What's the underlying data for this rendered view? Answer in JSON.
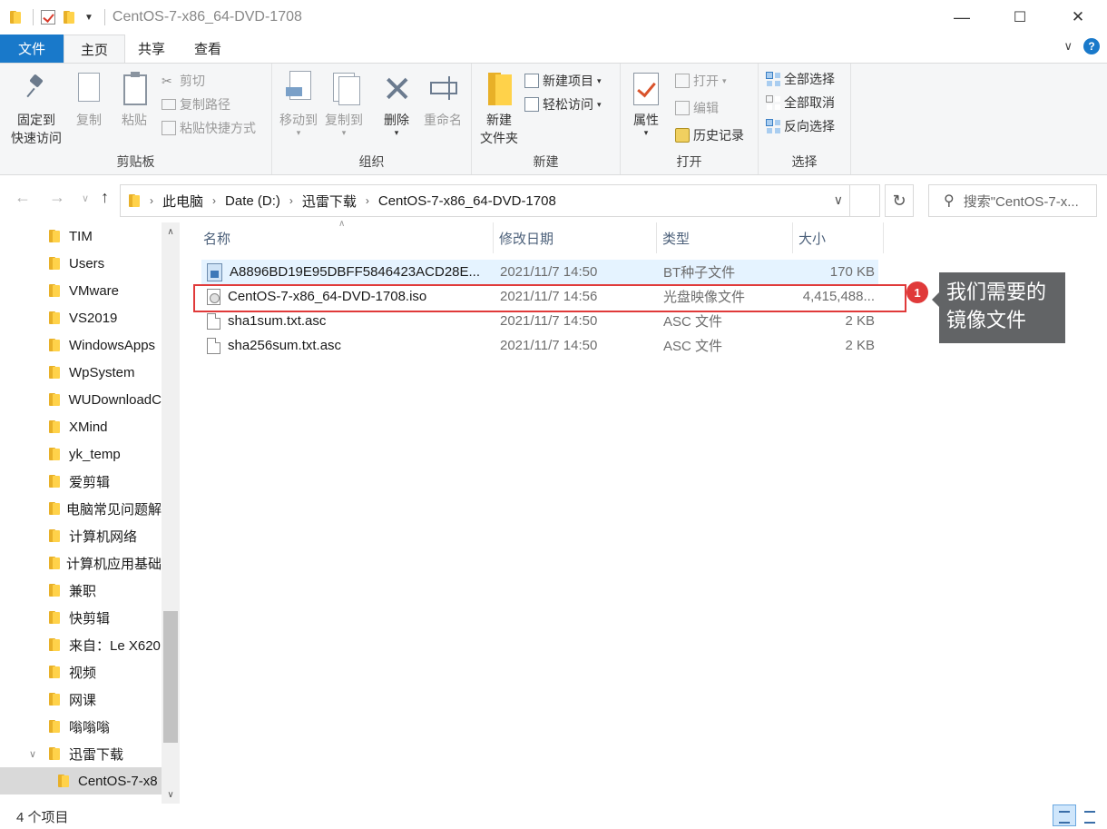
{
  "titlebar": {
    "title": "CentOS-7-x86_64-DVD-1708",
    "minimize": "—",
    "maximize": "☐",
    "close": "✕"
  },
  "tabs": {
    "file": "文件",
    "home": "主页",
    "share": "共享",
    "view": "查看"
  },
  "ribbon": {
    "clipboard": {
      "label": "剪贴板",
      "pin": [
        "固定到",
        "快速访问"
      ],
      "copy": "复制",
      "paste": "粘贴",
      "cut": "剪切",
      "copy_path": "复制路径",
      "paste_shortcut": "粘贴快捷方式"
    },
    "organize": {
      "label": "组织",
      "move_to": "移动到",
      "copy_to": "复制到",
      "delete": "删除",
      "rename": "重命名"
    },
    "new": {
      "label": "新建",
      "new_folder": [
        "新建",
        "文件夹"
      ],
      "new_item": "新建项目",
      "easy_access": "轻松访问"
    },
    "open": {
      "label": "打开",
      "properties": "属性",
      "open": "打开",
      "edit": "编辑",
      "history": "历史记录"
    },
    "select": {
      "label": "选择",
      "select_all": "全部选择",
      "select_none": "全部取消",
      "invert": "反向选择"
    }
  },
  "address": {
    "crumbs": [
      "此电脑",
      "Date (D:)",
      "迅雷下载",
      "CentOS-7-x86_64-DVD-1708"
    ],
    "search_placeholder": "搜索\"CentOS-7-x..."
  },
  "sidebar": {
    "items": [
      "TIM",
      "Users",
      "VMware",
      "VS2019",
      "WindowsApps",
      "WpSystem",
      "WUDownloadC",
      "XMind",
      "yk_temp",
      "爱剪辑",
      "电脑常见问题解",
      "计算机网络",
      "计算机应用基础",
      "兼职",
      "快剪辑",
      "来自：Le X620",
      "视频",
      "网课",
      "嗡嗡嗡",
      "迅雷下载"
    ],
    "selected": "CentOS-7-x8"
  },
  "columns": {
    "name": "名称",
    "date": "修改日期",
    "type": "类型",
    "size": "大小"
  },
  "files": [
    {
      "name": "A8896BD19E95DBFF5846423ACD28E...",
      "date": "2021/11/7 14:50",
      "type": "BT种子文件",
      "size": "170 KB",
      "icon": "torrent-file-icon"
    },
    {
      "name": "CentOS-7-x86_64-DVD-1708.iso",
      "date": "2021/11/7 14:56",
      "type": "光盘映像文件",
      "size": "4,415,488...",
      "icon": "disc-image-icon"
    },
    {
      "name": "sha1sum.txt.asc",
      "date": "2021/11/7 14:50",
      "type": "ASC 文件",
      "size": "2 KB",
      "icon": "file-icon"
    },
    {
      "name": "sha256sum.txt.asc",
      "date": "2021/11/7 14:50",
      "type": "ASC 文件",
      "size": "2 KB",
      "icon": "file-icon"
    }
  ],
  "annotation": {
    "badge": "1",
    "text_line1": "我们需要的",
    "text_line2": "镜像文件",
    "color": "#e03a3a"
  },
  "status": {
    "count": "4 个项目"
  }
}
